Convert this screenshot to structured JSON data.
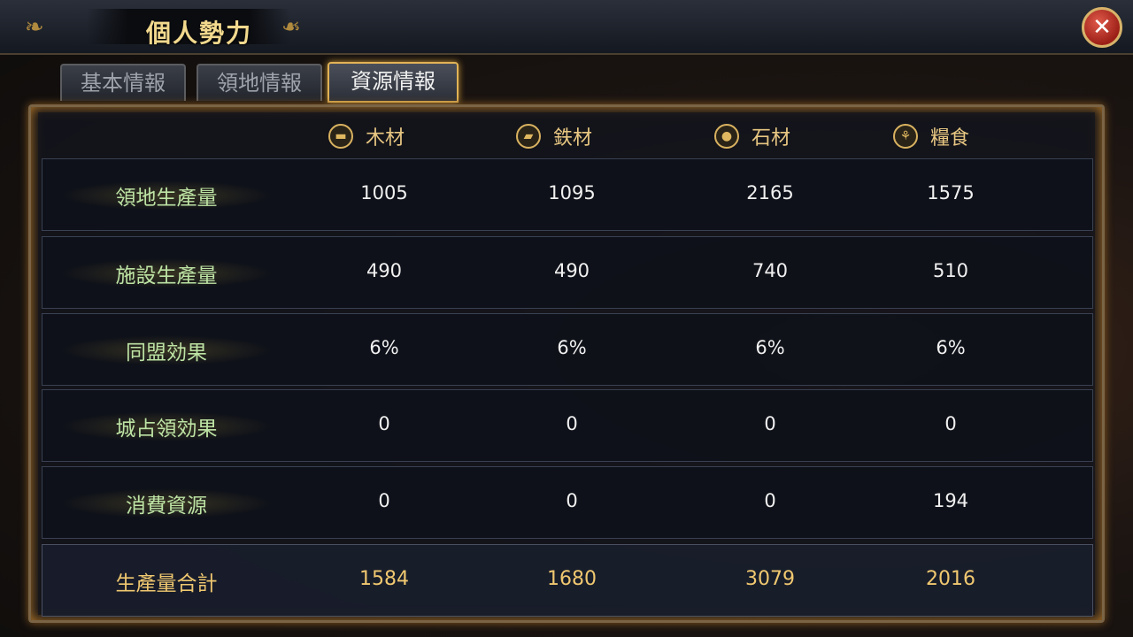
{
  "header": {
    "title": "個人勢力",
    "close_icon": "close-icon"
  },
  "tabs": [
    {
      "label": "基本情報",
      "active": false
    },
    {
      "label": "領地情報",
      "active": false
    },
    {
      "label": "資源情報",
      "active": true
    }
  ],
  "resources": [
    {
      "label": "木材",
      "icon": "wood-icon"
    },
    {
      "label": "鉄材",
      "icon": "iron-icon"
    },
    {
      "label": "石材",
      "icon": "stone-icon"
    },
    {
      "label": "糧食",
      "icon": "grain-icon"
    }
  ],
  "rows": [
    {
      "label": "領地生產量",
      "values": [
        "1005",
        "1095",
        "2165",
        "1575"
      ]
    },
    {
      "label": "施設生產量",
      "values": [
        "490",
        "490",
        "740",
        "510"
      ]
    },
    {
      "label": "同盟効果",
      "values": [
        "6%",
        "6%",
        "6%",
        "6%"
      ]
    },
    {
      "label": "城占領効果",
      "values": [
        "0",
        "0",
        "0",
        "0"
      ]
    },
    {
      "label": "消費資源",
      "values": [
        "0",
        "0",
        "0",
        "194"
      ]
    },
    {
      "label": "生產量合計",
      "values": [
        "1584",
        "1680",
        "3079",
        "2016"
      ]
    }
  ],
  "colors": {
    "accent_gold": "#f0c870",
    "label_green": "#bde3a4",
    "close_red": "#9c1f17"
  }
}
